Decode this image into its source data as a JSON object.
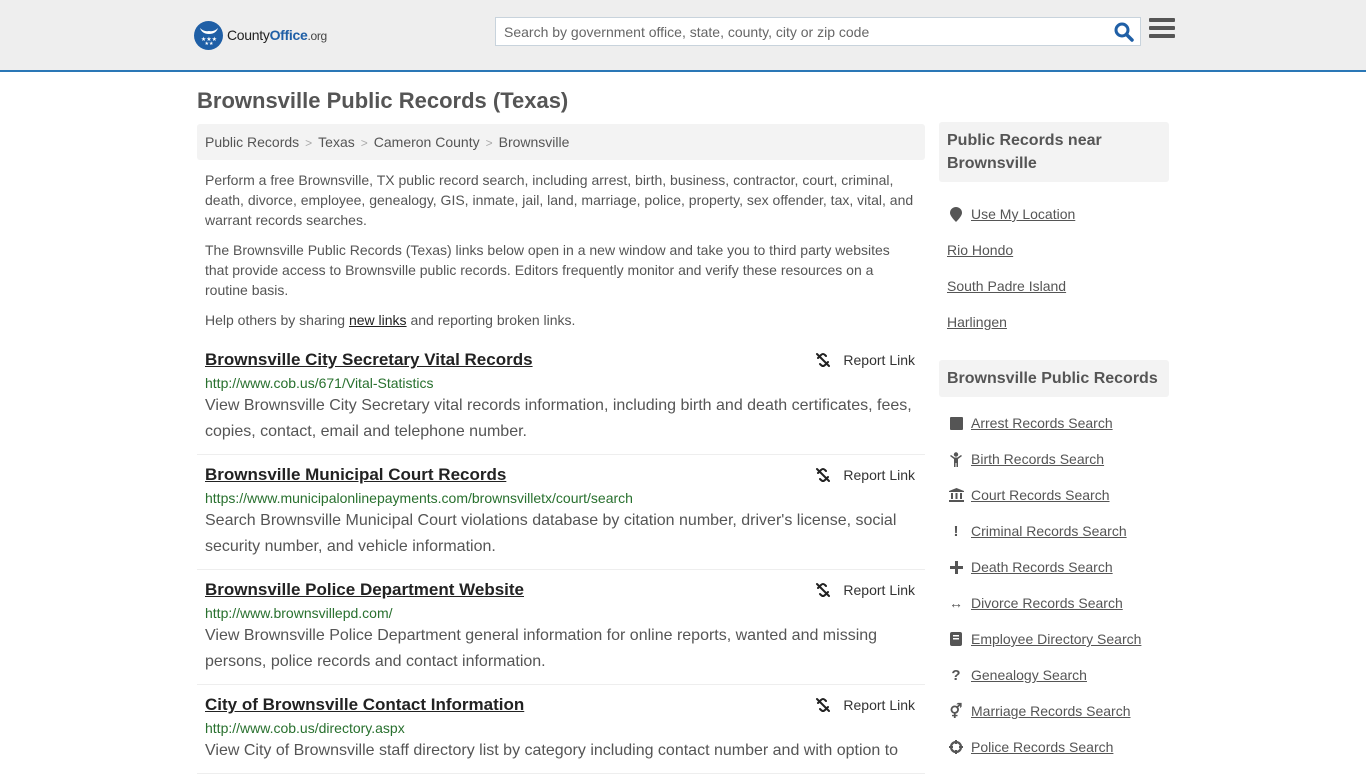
{
  "header": {
    "logo": {
      "part1": "County",
      "part2": "Office",
      "part3": ".org"
    },
    "search": {
      "placeholder": "Search by government office, state, county, city or zip code",
      "value": ""
    },
    "colors": {
      "brand": "#1f5fa6",
      "accent_border": "#2a77b6"
    }
  },
  "page": {
    "title": "Brownsville Public Records (Texas)"
  },
  "breadcrumb": [
    {
      "label": "Public Records"
    },
    {
      "label": "Texas"
    },
    {
      "label": "Cameron County"
    },
    {
      "label": "Brownsville"
    }
  ],
  "intro": {
    "p1": "Perform a free Brownsville, TX public record search, including arrest, birth, business, contractor, court, criminal, death, divorce, employee, genealogy, GIS, inmate, jail, land, marriage, police, property, sex offender, tax, vital, and warrant records searches.",
    "p2": "The Brownsville Public Records (Texas) links below open in a new window and take you to third party websites that provide access to Brownsville public records. Editors frequently monitor and verify these resources on a routine basis.",
    "p3_before": "Help others by sharing ",
    "p3_link": "new links",
    "p3_after": " and reporting broken links."
  },
  "records": [
    {
      "title": "Brownsville City Secretary Vital Records",
      "url": "http://www.cob.us/671/Vital-Statistics",
      "description": "View Brownsville City Secretary vital records information, including birth and death certificates, fees, copies, contact, email and telephone number.",
      "report_label": "Report Link"
    },
    {
      "title": "Brownsville Municipal Court Records",
      "url": "https://www.municipalonlinepayments.com/brownsvilletx/court/search",
      "description": "Search Brownsville Municipal Court violations database by citation number, driver's license, social security number, and vehicle information.",
      "report_label": "Report Link"
    },
    {
      "title": "Brownsville Police Department Website",
      "url": "http://www.brownsvillepd.com/",
      "description": "View Brownsville Police Department general information for online reports, wanted and missing persons, police records and contact information.",
      "report_label": "Report Link"
    },
    {
      "title": "City of Brownsville Contact Information",
      "url": "http://www.cob.us/directory.aspx",
      "description": "View City of Brownsville staff directory list by category including contact number and with option to",
      "report_label": "Report Link"
    }
  ],
  "sidebar": {
    "nearby": {
      "heading": "Public Records near Brownsville",
      "items": [
        {
          "label": "Use My Location",
          "icon": "map-marker-icon"
        },
        {
          "label": "Rio Hondo"
        },
        {
          "label": "South Padre Island"
        },
        {
          "label": "Harlingen"
        }
      ]
    },
    "records": {
      "heading": "Brownsville Public Records",
      "items": [
        {
          "label": "Arrest Records Search",
          "icon": "square-icon"
        },
        {
          "label": "Birth Records Search",
          "icon": "child-icon"
        },
        {
          "label": "Court Records Search",
          "icon": "courthouse-icon"
        },
        {
          "label": "Criminal Records Search",
          "icon": "exclamation-icon"
        },
        {
          "label": "Death Records Search",
          "icon": "plus-icon"
        },
        {
          "label": "Divorce Records Search",
          "icon": "arrows-horizontal-icon"
        },
        {
          "label": "Employee Directory Search",
          "icon": "book-icon"
        },
        {
          "label": "Genealogy Search",
          "icon": "question-icon"
        },
        {
          "label": "Marriage Records Search",
          "icon": "gender-icon"
        },
        {
          "label": "Police Records Search",
          "icon": "crosshairs-icon"
        }
      ]
    }
  }
}
